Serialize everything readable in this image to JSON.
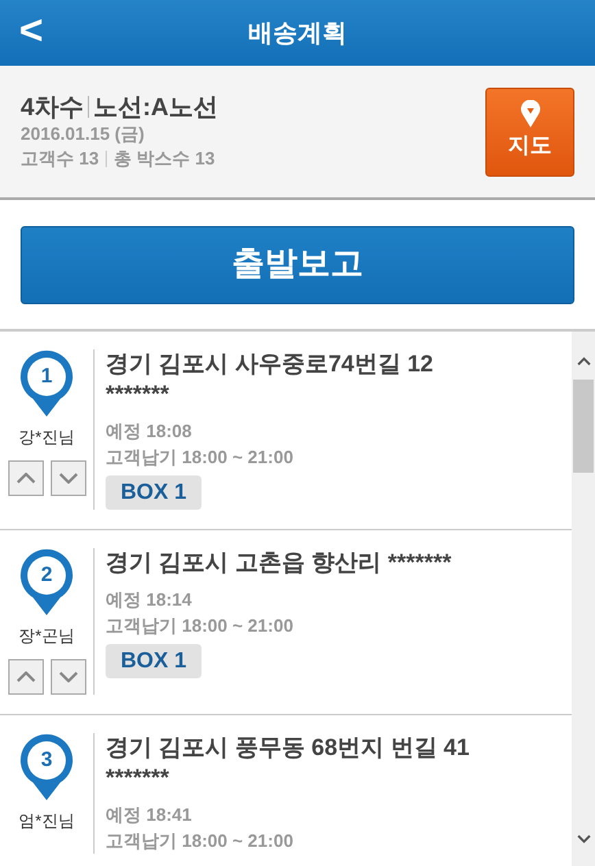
{
  "header": {
    "back": "<",
    "title": "배송계획"
  },
  "plan": {
    "round": "4차수",
    "route": "노선:A노선",
    "date": "2016.01.15 (금)",
    "customers": "고객수 13",
    "boxes": "총 박스수 13",
    "map_button": "지도"
  },
  "depart_button": "출발보고",
  "stops": [
    {
      "number": "1",
      "name": "강*진님",
      "address": "경기 김포시 사우중로74번길 12 *******",
      "eta": "예정 18:08",
      "window": "고객납기 18:00 ~ 21:00",
      "box": "BOX 1",
      "reorder": true
    },
    {
      "number": "2",
      "name": "장*곤님",
      "address": "경기 김포시 고촌읍 향산리  *******",
      "eta": "예정 18:14",
      "window": "고객납기 18:00 ~ 21:00",
      "box": "BOX 1",
      "reorder": true
    },
    {
      "number": "3",
      "name": "엄*진님",
      "address": "경기 김포시 풍무동 68번지 번길 41 *******",
      "eta": "예정 18:41",
      "window": "고객납기 18:00 ~ 21:00",
      "reorder": false
    }
  ]
}
